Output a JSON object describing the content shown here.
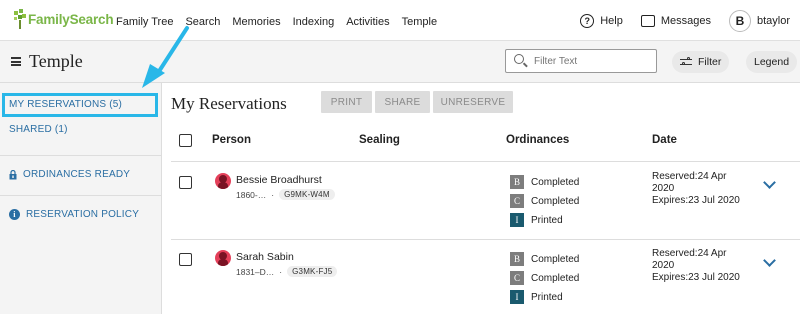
{
  "nav": {
    "logo": "FamilySearch",
    "links": [
      "Family Tree",
      "Search",
      "Memories",
      "Indexing",
      "Activities",
      "Temple"
    ],
    "help": "Help",
    "messages": "Messages",
    "avatar_letter": "B",
    "username": "btaylor"
  },
  "subheader": {
    "title": "Temple",
    "filter_placeholder": "Filter Text",
    "filter_label": "Filter",
    "legend_label": "Legend"
  },
  "sidebar": {
    "my_reservations": "MY RESERVATIONS (5)",
    "shared": "SHARED (1)",
    "ordinances_ready": "ORDINANCES READY",
    "reservation_policy": "RESERVATION POLICY"
  },
  "main": {
    "title": "My Reservations",
    "buttons": {
      "print": "PRINT",
      "share": "SHARE",
      "unreserve": "UNRESERVE"
    },
    "columns": {
      "person": "Person",
      "sealing": "Sealing",
      "ordinances": "Ordinances",
      "date": "Date"
    },
    "rows": [
      {
        "name": "Bessie Broadhurst",
        "lifespan": "1860-…",
        "separator": "·",
        "pid": "G9MK-W4M",
        "ordinances": [
          {
            "letter": "B",
            "status": "Completed"
          },
          {
            "letter": "C",
            "status": "Completed"
          },
          {
            "letter": "I",
            "status": "Printed"
          }
        ],
        "reserved": "Reserved:24 Apr 2020",
        "expires": "Expires:23 Jul 2020"
      },
      {
        "name": "Sarah Sabin",
        "lifespan": "1831–D…",
        "separator": "·",
        "pid": "G3MK-FJ5",
        "ordinances": [
          {
            "letter": "B",
            "status": "Completed"
          },
          {
            "letter": "C",
            "status": "Completed"
          },
          {
            "letter": "I",
            "status": "Printed"
          }
        ],
        "reserved": "Reserved:24 Apr 2020",
        "expires": "Expires:23 Jul 2020"
      }
    ]
  },
  "colors": {
    "accent_blue": "#2a6ea3",
    "highlight": "#29b7e8",
    "brand_green": "#7ab648",
    "female_icon": "#e4405a",
    "initiatory_badge": "#1a5a6e"
  }
}
